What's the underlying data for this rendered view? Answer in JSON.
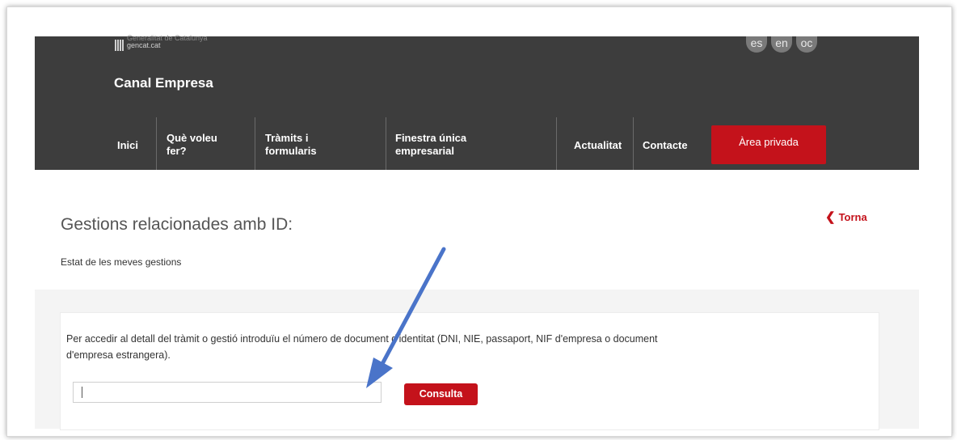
{
  "header": {
    "logo_line1": "Generalitat de Catalunya",
    "logo_line2": "gencat.cat",
    "site_title": "Canal Empresa",
    "languages": [
      "es",
      "en",
      "oc"
    ]
  },
  "nav": {
    "items": [
      {
        "label": "Inici"
      },
      {
        "label": "Què voleu fer?"
      },
      {
        "label": "Tràmits i formularis"
      },
      {
        "label": "Finestra única empresarial"
      },
      {
        "label": "Actualitat"
      },
      {
        "label": "Contacte"
      }
    ],
    "private_area": "Àrea privada"
  },
  "main": {
    "title": "Gestions relacionades amb ID: ",
    "back_label": "Torna",
    "subtitle": "Estat de les meves gestions",
    "instructions": "Per accedir al detall del tràmit o gestió introduïu el número de document d'identitat (DNI, NIE, passaport, NIF d'empresa o document d'empresa estrangera).",
    "input_value": "",
    "consult_button": "Consulta"
  },
  "colors": {
    "header_bg": "#3d3d3d",
    "accent_red": "#c4121b",
    "annotation_arrow": "#4a74c9"
  },
  "icons": {
    "back": "chevron-left-icon",
    "annotation": "arrow-icon"
  }
}
